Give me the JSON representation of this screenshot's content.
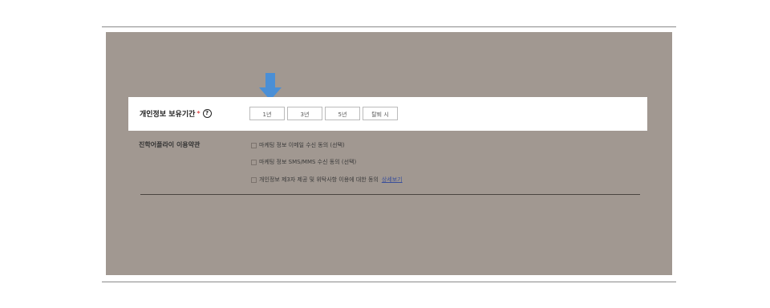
{
  "retention": {
    "label": "개인정보 보유기간",
    "required_mark": "*",
    "help_glyph": "?",
    "options": [
      "1년",
      "3년",
      "5년",
      "탈퇴 시"
    ]
  },
  "terms": {
    "label": "진학어플라이 이용약관",
    "items": [
      "마케팅 정보 이메일 수신 동의 (선택)",
      "마케팅 정보 SMS/MMS 수신 동의 (선택)",
      "개인정보 제3자 제공 및 위탁사항 이용에 대한 동의"
    ],
    "detail_link": "상세보기"
  },
  "colors": {
    "overlay": "#a19891",
    "arrow": "#4a8fd6",
    "link": "#3a4f9a"
  }
}
